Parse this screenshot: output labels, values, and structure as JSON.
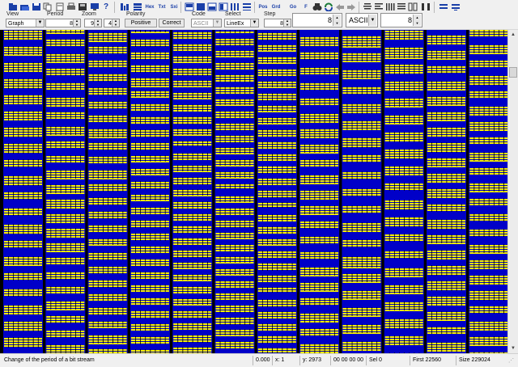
{
  "toolbar": {
    "text_buttons": {
      "hex": "Hex",
      "txt": "Txt",
      "sxi": "Sxi",
      "pos": "Pos",
      "grid": "Grd",
      "go": "Go",
      "f": "F"
    },
    "view": {
      "label": "View",
      "value": "Graph"
    },
    "period": {
      "label": "Period",
      "value": "8"
    },
    "zoom": {
      "label": "Zoom",
      "x_value": "9",
      "y_value": "4"
    },
    "polarity": {
      "label": "Polarity",
      "positive_label": "Positive",
      "correct_label": "Correct"
    },
    "code": {
      "label": "Code",
      "value": "ASCII"
    },
    "select": {
      "label": "Select",
      "value": "LineEx"
    },
    "step": {
      "label": "Step",
      "value": "8"
    },
    "right_value_1": "8",
    "encoding_value": "ASCII",
    "right_value_2": "8"
  },
  "colors": {
    "bit_one": "#f8f000",
    "bit_zero": "#0000c8",
    "background": "#000000"
  },
  "status": {
    "message": "Change of the period of a bit stream",
    "value": "0.000",
    "x": "x: 1",
    "y": "y: 2973",
    "bytes": "00 00 00 00",
    "sel": "Sel 0",
    "first": "First 22560",
    "size": "Size 229024"
  }
}
